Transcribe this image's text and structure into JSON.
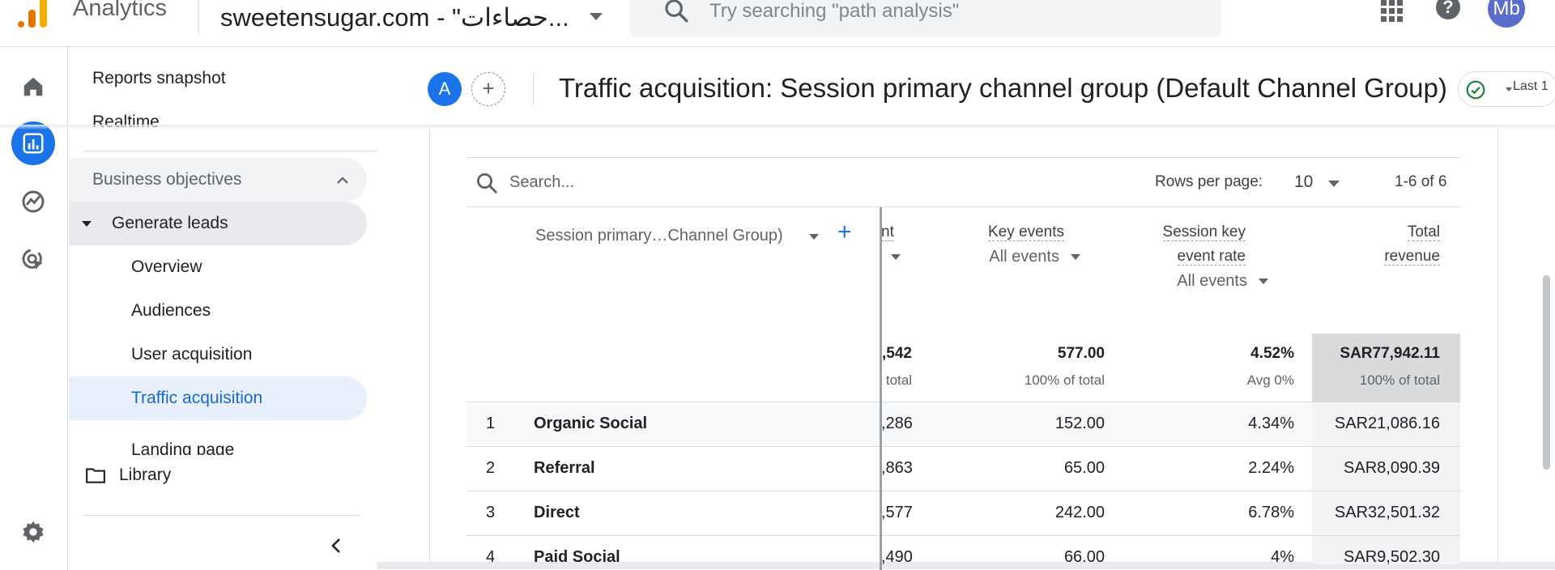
{
  "app": {
    "name": "Analytics",
    "property": "sweetensugar.com - \"حصاءات...",
    "search_placeholder": "Try searching \"path analysis\"",
    "avatar_initials": "Mb"
  },
  "nav": {
    "reports_snapshot": "Reports snapshot",
    "realtime": "Realtime",
    "group": "Business objectives",
    "parent": "Generate leads",
    "items": [
      "Overview",
      "Audiences",
      "User acquisition",
      "Traffic acquisition",
      "Landing page"
    ],
    "library": "Library"
  },
  "header": {
    "comparison_chip": "A",
    "add_comparison": "+",
    "title": "Traffic acquisition: Session primary channel group (Default Channel Group)",
    "date_range_fragment": "Last 1"
  },
  "table": {
    "search_placeholder": "Search...",
    "rows_per_page_label": "Rows per page:",
    "rows_per_page_value": "10",
    "pagination": "1-6 of 6",
    "dimension_header": "Session primary…Channel Group)",
    "clipped_header": "nt",
    "metrics": [
      {
        "label_lines": [
          "Key events"
        ],
        "sub": "All events"
      },
      {
        "label_lines": [
          "Session key",
          "event rate"
        ],
        "sub": "All events"
      },
      {
        "label_lines": [
          "Total",
          "revenue"
        ],
        "sub": ""
      }
    ],
    "totals": {
      "clipped": ",542",
      "clipped_sub": "total",
      "key_events": "577.00",
      "key_events_sub": "100% of total",
      "rate": "4.52%",
      "rate_sub": "Avg 0%",
      "revenue": "SAR77,942.11",
      "revenue_sub": "100% of total"
    },
    "rows": [
      {
        "n": "1",
        "channel": "Organic Social",
        "clipped": ",286",
        "key_events": "152.00",
        "rate": "4.34%",
        "revenue": "SAR21,086.16"
      },
      {
        "n": "2",
        "channel": "Referral",
        "clipped": ",863",
        "key_events": "65.00",
        "rate": "2.24%",
        "revenue": "SAR8,090.39"
      },
      {
        "n": "3",
        "channel": "Direct",
        "clipped": ",577",
        "key_events": "242.00",
        "rate": "6.78%",
        "revenue": "SAR32,501.32"
      },
      {
        "n": "4",
        "channel": "Paid Social",
        "clipped": ",490",
        "key_events": "66.00",
        "rate": "4%",
        "revenue": "SAR9,502.30"
      }
    ]
  },
  "colors": {
    "accent": "#1a73e8",
    "selected_bg": "#e8f0fe",
    "logo_orange": "#f9ab00",
    "status_green": "#188038"
  }
}
